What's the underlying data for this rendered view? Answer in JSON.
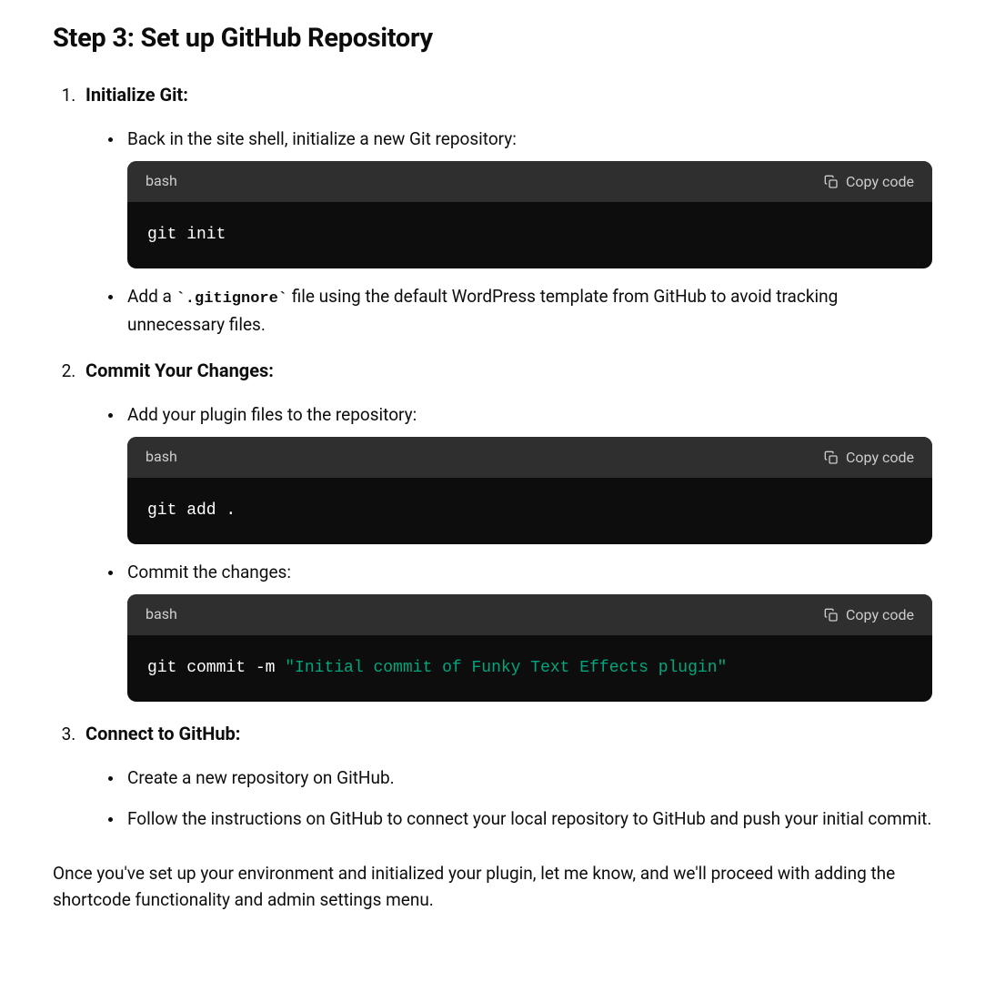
{
  "heading": "Step 3: Set up GitHub Repository",
  "copy_label": "Copy code",
  "items": [
    {
      "title": "Initialize Git:",
      "bullets": [
        {
          "text": "Back in the site shell, initialize a new Git repository:",
          "code": {
            "lang": "bash",
            "plain": "git init"
          }
        },
        {
          "pre": "Add a ",
          "inline_code": "`.gitignore`",
          "post": " file using the default WordPress template from GitHub to avoid tracking unnecessary files."
        }
      ]
    },
    {
      "title": "Commit Your Changes:",
      "bullets": [
        {
          "text": "Add your plugin files to the repository:",
          "code": {
            "lang": "bash",
            "plain": "git add ."
          }
        },
        {
          "text": "Commit the changes:",
          "code": {
            "lang": "bash",
            "cmd_prefix": "git commit -m ",
            "str": "\"Initial commit of Funky Text Effects plugin\""
          }
        }
      ]
    },
    {
      "title": "Connect to GitHub:",
      "bullets": [
        {
          "text": "Create a new repository on GitHub."
        },
        {
          "text": "Follow the instructions on GitHub to connect your local repository to GitHub and push your initial commit."
        }
      ]
    }
  ],
  "closing": "Once you've set up your environment and initialized your plugin, let me know, and we'll proceed with adding the shortcode functionality and admin settings menu."
}
